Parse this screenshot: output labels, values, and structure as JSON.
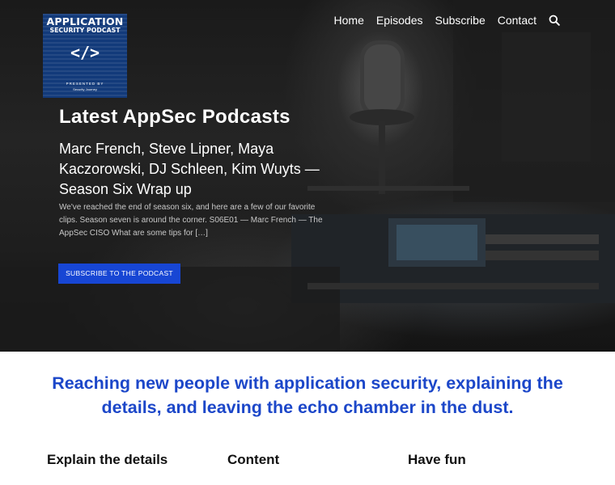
{
  "logo": {
    "line1": "APPLICATION",
    "line2": "SECURITY PODCAST",
    "code_glyph": "</>",
    "presented_by": "PRESENTED BY",
    "sponsor": "Security Journey"
  },
  "nav": {
    "items": [
      {
        "label": "Home"
      },
      {
        "label": "Episodes"
      },
      {
        "label": "Subscribe"
      },
      {
        "label": "Contact"
      }
    ],
    "search_icon": "search-icon"
  },
  "hero": {
    "title": "Latest AppSec Podcasts",
    "post_title": "Marc French, Steve Lipner, Maya Kaczorowski, DJ Schleen, Kim Wuyts — Season Six Wrap up",
    "excerpt": "We've reached the end of season six, and here are a few of our favorite clips. Season seven is around the corner. S06E01 — Marc French — The AppSec CISO What are some tips for […]",
    "cta_label": "Subscribe to the podcast"
  },
  "tagline": "Reaching new people with application security, explaining the details, and leaving the echo chamber in the dust.",
  "features": [
    {
      "title": "Explain the details"
    },
    {
      "title": "Content"
    },
    {
      "title": "Have fun"
    }
  ],
  "colors": {
    "accent": "#1c47c9",
    "button": "#1746d4",
    "logo_bg": "#123a7a"
  }
}
